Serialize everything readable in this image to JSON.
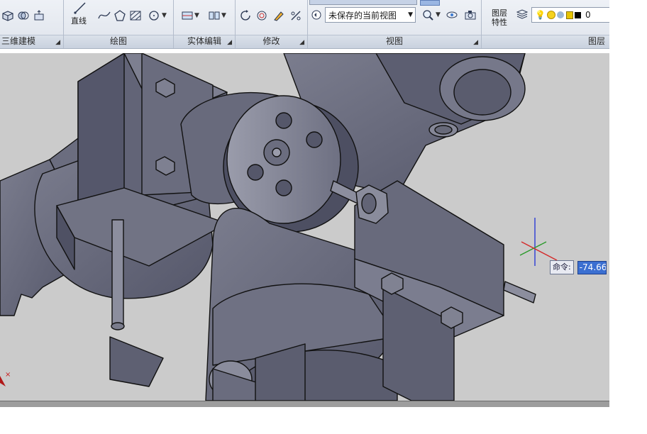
{
  "ribbon": {
    "panels": [
      {
        "title": "三维建模"
      },
      {
        "title": "绘图"
      },
      {
        "title": "实体编辑"
      },
      {
        "title": "修改"
      },
      {
        "title": "视图"
      },
      {
        "title": "图层"
      }
    ],
    "draw": {
      "line_label": "直线"
    },
    "view": {
      "named_view_value": "未保存的当前视图"
    },
    "layers": {
      "properties_label_line1": "图层",
      "properties_label_line2": "特性",
      "current_layer": "0"
    }
  },
  "command": {
    "prompt_label": "命令:",
    "input_value": "-74.66"
  },
  "colors": {
    "viewport_bg": "#cbcbcb",
    "model_body": "#636579",
    "model_highlight": "#8a8c9c",
    "ucs_x": "#d42a2a",
    "ucs_y": "#2a9a2a",
    "ucs_z": "#2a3ad4"
  },
  "icons": [
    "box-icon",
    "subtract-icon",
    "extrude-icon",
    "line-icon",
    "spline-icon",
    "polygon-icon",
    "hatch-icon",
    "circle-icon",
    "slice-icon",
    "separate-icon",
    "rotate-icon",
    "offset-icon",
    "match-icon",
    "scale-icon",
    "view-icon",
    "zoom-icon",
    "orbit-icon",
    "camera-icon",
    "layer-properties-icon",
    "layer-state-icon",
    "lightbulb-icon",
    "sun-icon",
    "lock-icon",
    "color-swatch-icon",
    "ucs-icon"
  ]
}
